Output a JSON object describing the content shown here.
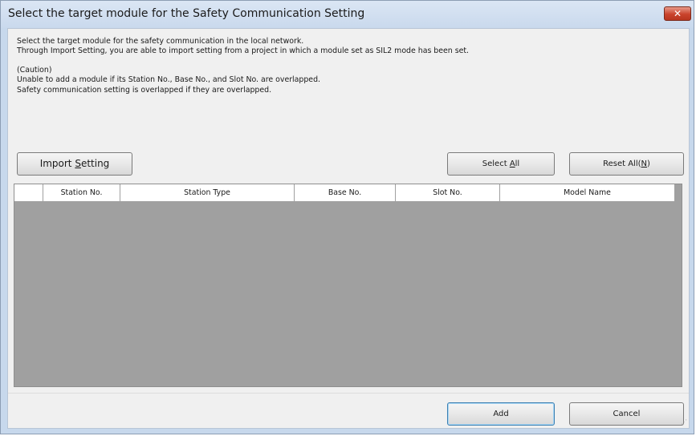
{
  "window": {
    "title": "Select the target module for the Safety Communication Setting",
    "close_glyph": "✕"
  },
  "description": {
    "line1": "Select the target module for the safety communication in the local network.",
    "line2": "Through Import Setting, you are able to import setting from a project in which a module set as SIL2 mode has been set.",
    "caution_heading": "(Caution)",
    "caution_line1": "Unable to add a module if its Station No., Base No., and Slot No. are overlapped.",
    "caution_line2": "Safety communication setting is overlapped if they are overlapped."
  },
  "toolbar": {
    "import_label_pre": "Import ",
    "import_label_key": "S",
    "import_label_post": "etting",
    "select_all_pre": "Select ",
    "select_all_key": "A",
    "select_all_post": "ll",
    "reset_all_pre": "Reset All(",
    "reset_all_key": "N",
    "reset_all_post": ")"
  },
  "table": {
    "columns": [
      "",
      "Station No.",
      "Station Type",
      "Base No.",
      "Slot No.",
      "Model Name"
    ],
    "rows": []
  },
  "footer": {
    "add_label": "Add",
    "cancel_label": "Cancel",
    "size_grip_glyph": "⋰"
  },
  "colors": {
    "title_bar": "#c9d9ed",
    "client_bg": "#f0f0f0",
    "grid_empty_bg": "#a0a0a0",
    "close_button": "#c9432c",
    "primary_border": "#3c7fb1"
  }
}
